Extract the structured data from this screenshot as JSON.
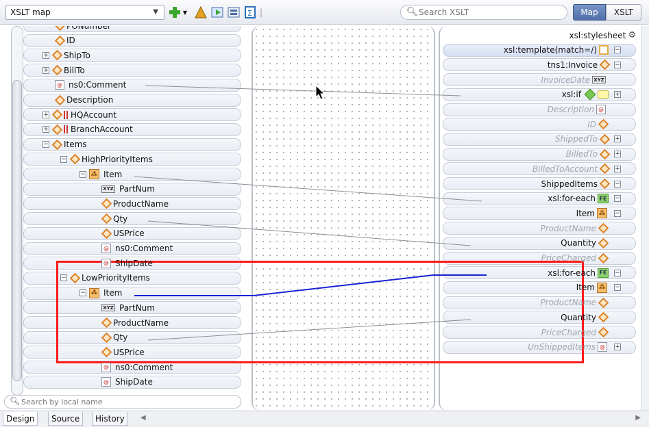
{
  "toolbar": {
    "map_combo": "XSLT map",
    "search_placeholder": "Search XSLT",
    "view_map": "Map",
    "view_xslt": "XSLT"
  },
  "source_tree": [
    {
      "label": "PONumber",
      "icon": "element-icon",
      "level": 2,
      "toggle": ""
    },
    {
      "label": "ID",
      "icon": "element-icon",
      "level": 2,
      "toggle": ""
    },
    {
      "label": "ShipTo",
      "icon": "element-icon",
      "level": 1,
      "toggle": "+"
    },
    {
      "label": "BillTo",
      "icon": "element-icon",
      "level": 1,
      "toggle": "+"
    },
    {
      "label": "ns0:Comment",
      "icon": "attribute-icon",
      "level": 2,
      "toggle": ""
    },
    {
      "label": "Description",
      "icon": "element-icon",
      "level": 2,
      "toggle": ""
    },
    {
      "label": "HQAccount",
      "icon": "element-icon",
      "level": 1,
      "toggle": "+",
      "flag": true
    },
    {
      "label": "BranchAccount",
      "icon": "element-icon",
      "level": 1,
      "toggle": "+",
      "flag": true
    },
    {
      "label": "Items",
      "icon": "element-icon",
      "level": 1,
      "toggle": "-"
    },
    {
      "label": "HighPriorityItems",
      "icon": "element-icon",
      "level": 3,
      "toggle": "-"
    },
    {
      "label": "Item",
      "icon": "repeating-element-icon",
      "level": 4,
      "toggle": "-"
    },
    {
      "label": "PartNum",
      "icon": "xyz-type-icon",
      "level": 5,
      "toggle": ""
    },
    {
      "label": "ProductName",
      "icon": "element-icon",
      "level": 5,
      "toggle": ""
    },
    {
      "label": "Qty",
      "icon": "element-icon",
      "level": 5,
      "toggle": ""
    },
    {
      "label": "USPrice",
      "icon": "element-icon",
      "level": 5,
      "toggle": ""
    },
    {
      "label": "ns0:Comment",
      "icon": "attribute-icon",
      "level": 5,
      "toggle": ""
    },
    {
      "label": "ShipDate",
      "icon": "attribute-icon",
      "level": 5,
      "toggle": ""
    },
    {
      "label": "LowPriorityItems",
      "icon": "element-icon",
      "level": 3,
      "toggle": "-"
    },
    {
      "label": "Item",
      "icon": "repeating-element-icon",
      "level": 4,
      "toggle": "-"
    },
    {
      "label": "PartNum",
      "icon": "xyz-type-icon",
      "level": 5,
      "toggle": ""
    },
    {
      "label": "ProductName",
      "icon": "element-icon",
      "level": 5,
      "toggle": ""
    },
    {
      "label": "Qty",
      "icon": "element-icon",
      "level": 5,
      "toggle": ""
    },
    {
      "label": "USPrice",
      "icon": "element-icon",
      "level": 5,
      "toggle": ""
    },
    {
      "label": "ns0:Comment",
      "icon": "attribute-icon",
      "level": 5,
      "toggle": ""
    },
    {
      "label": "ShipDate",
      "icon": "attribute-icon",
      "level": 5,
      "toggle": ""
    }
  ],
  "target_tree": [
    {
      "label": "xsl:stylesheet",
      "ghost": false,
      "icons": [
        "stylesheet-icon"
      ],
      "toggle": ""
    },
    {
      "label": "xsl:template(match=/)",
      "ghost": false,
      "icons": [
        "template-icon"
      ],
      "toggle": "-"
    },
    {
      "label": "tns1:Invoice",
      "ghost": false,
      "icons": [
        "element-icon"
      ],
      "toggle": "-"
    },
    {
      "label": "InvoiceDate",
      "ghost": true,
      "icons": [
        "xyz-type-icon"
      ],
      "toggle": ""
    },
    {
      "label": "xsl:if",
      "ghost": false,
      "icons": [
        "if-icon",
        "note-icon"
      ],
      "toggle": "+"
    },
    {
      "label": "Description",
      "ghost": true,
      "icons": [
        "attribute-icon"
      ],
      "toggle": ""
    },
    {
      "label": "ID",
      "ghost": true,
      "icons": [
        "element-icon"
      ],
      "toggle": ""
    },
    {
      "label": "ShippedTo",
      "ghost": true,
      "icons": [
        "element-icon"
      ],
      "toggle": "+"
    },
    {
      "label": "BilledTo",
      "ghost": true,
      "icons": [
        "element-icon"
      ],
      "toggle": "+"
    },
    {
      "label": "BilledToAccount",
      "ghost": true,
      "icons": [
        "element-icon"
      ],
      "toggle": "+"
    },
    {
      "label": "ShippedItems",
      "ghost": false,
      "icons": [
        "element-icon"
      ],
      "toggle": "-"
    },
    {
      "label": "xsl:for-each",
      "ghost": false,
      "icons": [
        "for-each-icon"
      ],
      "toggle": "-"
    },
    {
      "label": "Item",
      "ghost": false,
      "icons": [
        "repeating-element-icon"
      ],
      "toggle": "-"
    },
    {
      "label": "ProductName",
      "ghost": true,
      "icons": [
        "element-icon"
      ],
      "toggle": ""
    },
    {
      "label": "Quantity",
      "ghost": false,
      "icons": [
        "element-icon"
      ],
      "toggle": ""
    },
    {
      "label": "PriceCharged",
      "ghost": true,
      "icons": [
        "element-icon"
      ],
      "toggle": ""
    },
    {
      "label": "xsl:for-each",
      "ghost": false,
      "icons": [
        "for-each-icon"
      ],
      "toggle": "-"
    },
    {
      "label": "Item",
      "ghost": false,
      "icons": [
        "repeating-element-icon"
      ],
      "toggle": "-"
    },
    {
      "label": "ProductName",
      "ghost": true,
      "icons": [
        "element-icon"
      ],
      "toggle": ""
    },
    {
      "label": "Quantity",
      "ghost": false,
      "icons": [
        "element-icon"
      ],
      "toggle": ""
    },
    {
      "label": "PriceCharged",
      "ghost": true,
      "icons": [
        "element-icon"
      ],
      "toggle": ""
    },
    {
      "label": "UnShippedItems",
      "ghost": true,
      "icons": [
        "attribute-icon"
      ],
      "toggle": "+"
    }
  ],
  "bottom": {
    "search_placeholder": "Search by local name",
    "tabs": [
      "Design",
      "Source",
      "History"
    ]
  },
  "colors": {
    "selected_wire": "#1a22d6",
    "wire": "#8a8f98",
    "highlight_box": "#ff1a1a",
    "map_button": "#5b78b2"
  }
}
